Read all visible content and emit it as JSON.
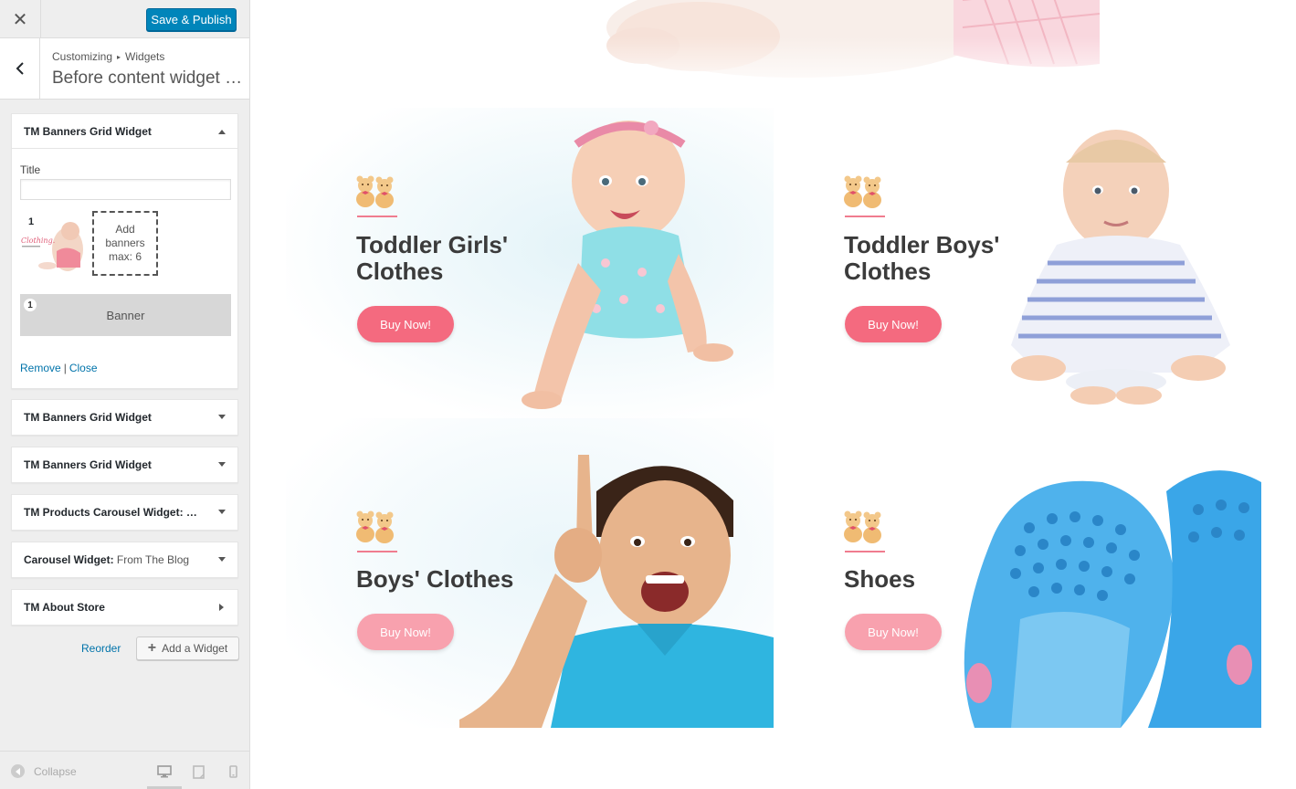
{
  "topbar": {
    "close_glyph": "✕",
    "publish_label": "Save & Publish"
  },
  "section": {
    "breadcrumb_root": "Customizing",
    "breadcrumb_sep": "▸",
    "breadcrumb_child": "Widgets",
    "title": "Before content widget area"
  },
  "widgets": [
    {
      "title": "TM Banners Grid Widget",
      "expanded": true,
      "arrow_icon": "triangle-up-icon"
    },
    {
      "title": "TM Banners Grid Widget",
      "expanded": false,
      "arrow_icon": "triangle-down-icon"
    },
    {
      "title": "TM Banners Grid Widget",
      "expanded": false,
      "arrow_icon": "triangle-down-icon"
    },
    {
      "title": "TM Products Carousel Widget: Sale",
      "expanded": false,
      "arrow_icon": "triangle-down-icon"
    },
    {
      "title": "Carousel Widget:",
      "in_title": "From The Blog",
      "expanded": false,
      "arrow_icon": "triangle-down-icon"
    },
    {
      "title": "TM About Store",
      "expanded": false,
      "arrow_icon": "triangle-right-icon"
    }
  ],
  "widget_form": {
    "title_label": "Title",
    "title_value": "",
    "banner_count": "1",
    "thumb_text": "Clothing.",
    "add_banners_line1": "Add",
    "add_banners_line2": "banners",
    "add_banners_line3": "max: 6",
    "banner_item_number": "1",
    "banner_item_label": "Banner",
    "remove_label": "Remove",
    "separator": "|",
    "close_label": "Close"
  },
  "actions": {
    "reorder_label": "Reorder",
    "add_widget_plus": "+",
    "add_widget_label": "Add a Widget"
  },
  "footer": {
    "collapse_label": "Collapse"
  },
  "preview": {
    "cards": [
      {
        "title_line1": "Toddler Girls'",
        "title_line2": "Clothes",
        "button": "Buy Now!"
      },
      {
        "title_line1": "Toddler Boys'",
        "title_line2": "Clothes",
        "button": "Buy Now!"
      },
      {
        "title_line1": "Boys' Clothes",
        "title_line2": "",
        "button": "Buy Now!"
      },
      {
        "title_line1": "Shoes",
        "title_line2": "",
        "button": "Buy Now!"
      }
    ]
  },
  "colors": {
    "publish_blue": "#0085ba",
    "link_blue": "#0073aa",
    "buy_pink": "#f46a7f",
    "buy_pink_soft": "#f8a1ae",
    "accent_line": "#f07c8f"
  }
}
